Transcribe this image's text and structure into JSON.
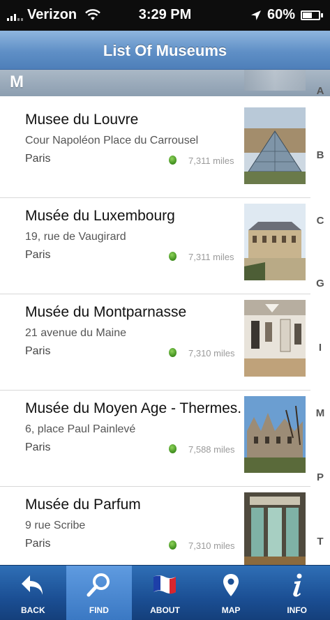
{
  "status_bar": {
    "carrier": "Verizon",
    "time": "3:29 PM",
    "battery": "60%",
    "battery_level": 0.6
  },
  "nav": {
    "title": "List Of Museums"
  },
  "section": {
    "letter": "M"
  },
  "museums": [
    {
      "name": "Musee du Louvre",
      "address": "Cour Napoléon Place du Carrousel",
      "city": "Paris",
      "distance": "7,311 miles"
    },
    {
      "name": "Musée du Luxembourg",
      "address": "19, rue de Vaugirard",
      "city": "Paris",
      "distance": "7,311 miles"
    },
    {
      "name": "Musée du Montparnasse",
      "address": "21 avenue du Maine",
      "city": "Paris",
      "distance": "7,310 miles"
    },
    {
      "name": "Musée du Moyen Age - Thermes.",
      "address": "6, place Paul Painlevé",
      "city": "Paris",
      "distance": "7,588 miles"
    },
    {
      "name": "Musée du Parfum",
      "address": "9 rue Scribe",
      "city": "Paris",
      "distance": "7,310 miles"
    }
  ],
  "index_letters": [
    "A",
    "B",
    "C",
    "G",
    "I",
    "M",
    "P",
    "T"
  ],
  "tabs": [
    {
      "label": "BACK",
      "icon": "back-arrow-icon"
    },
    {
      "label": "FIND",
      "icon": "magnifier-icon"
    },
    {
      "label": "ABOUT",
      "icon": "french-flag-icon"
    },
    {
      "label": "MAP",
      "icon": "map-pin-icon"
    },
    {
      "label": "INFO",
      "icon": "info-icon"
    }
  ],
  "colors": {
    "nav_blue": "#5f8fc6",
    "tab_blue": "#1b4f94",
    "distance_dot": "#3f8e1e"
  }
}
